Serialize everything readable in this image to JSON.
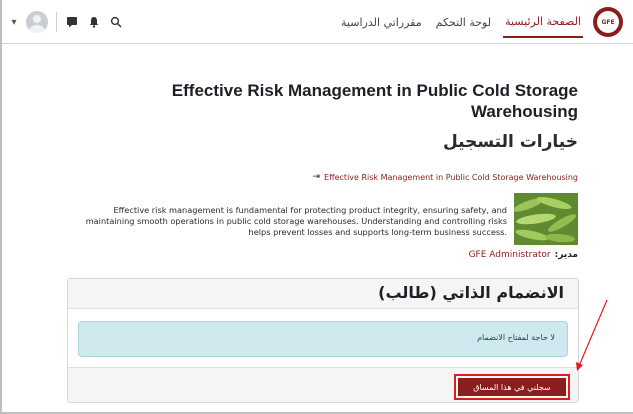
{
  "navbar": {
    "logo_text": "GFE",
    "links": [
      {
        "label": "الصفحة الرئيسية",
        "active": true
      },
      {
        "label": "لوحة التحكم",
        "active": false
      },
      {
        "label": "مقرراتي الدراسية",
        "active": false
      }
    ],
    "icons": [
      "chevron-down-icon",
      "avatar",
      "chat-icon",
      "bell-icon",
      "search-icon"
    ]
  },
  "page": {
    "title": "Effective Risk Management in Public Cold Storage Warehousing",
    "subtitle": "خيارات التسجيل",
    "course_link": "Effective Risk Management in Public Cold Storage Warehousing",
    "summary": "Effective risk management is fundamental for protecting product integrity, ensuring safety, and maintaining smooth operations in public cold storage warehouses. Understanding and controlling risks helps prevent losses and supports long-term business success.",
    "manager_label": "مدير:",
    "manager_name": "GFE Administrator"
  },
  "enrol": {
    "title": "الانضمام الذاتي (طالب)",
    "notice": "لا حاجة لمفتاح الانضمام",
    "button": "سجلني في هذا المساق"
  },
  "colors": {
    "accent": "#8b1d1d",
    "alert_bg": "#cfe9ee",
    "highlight": "#e01b1b"
  }
}
